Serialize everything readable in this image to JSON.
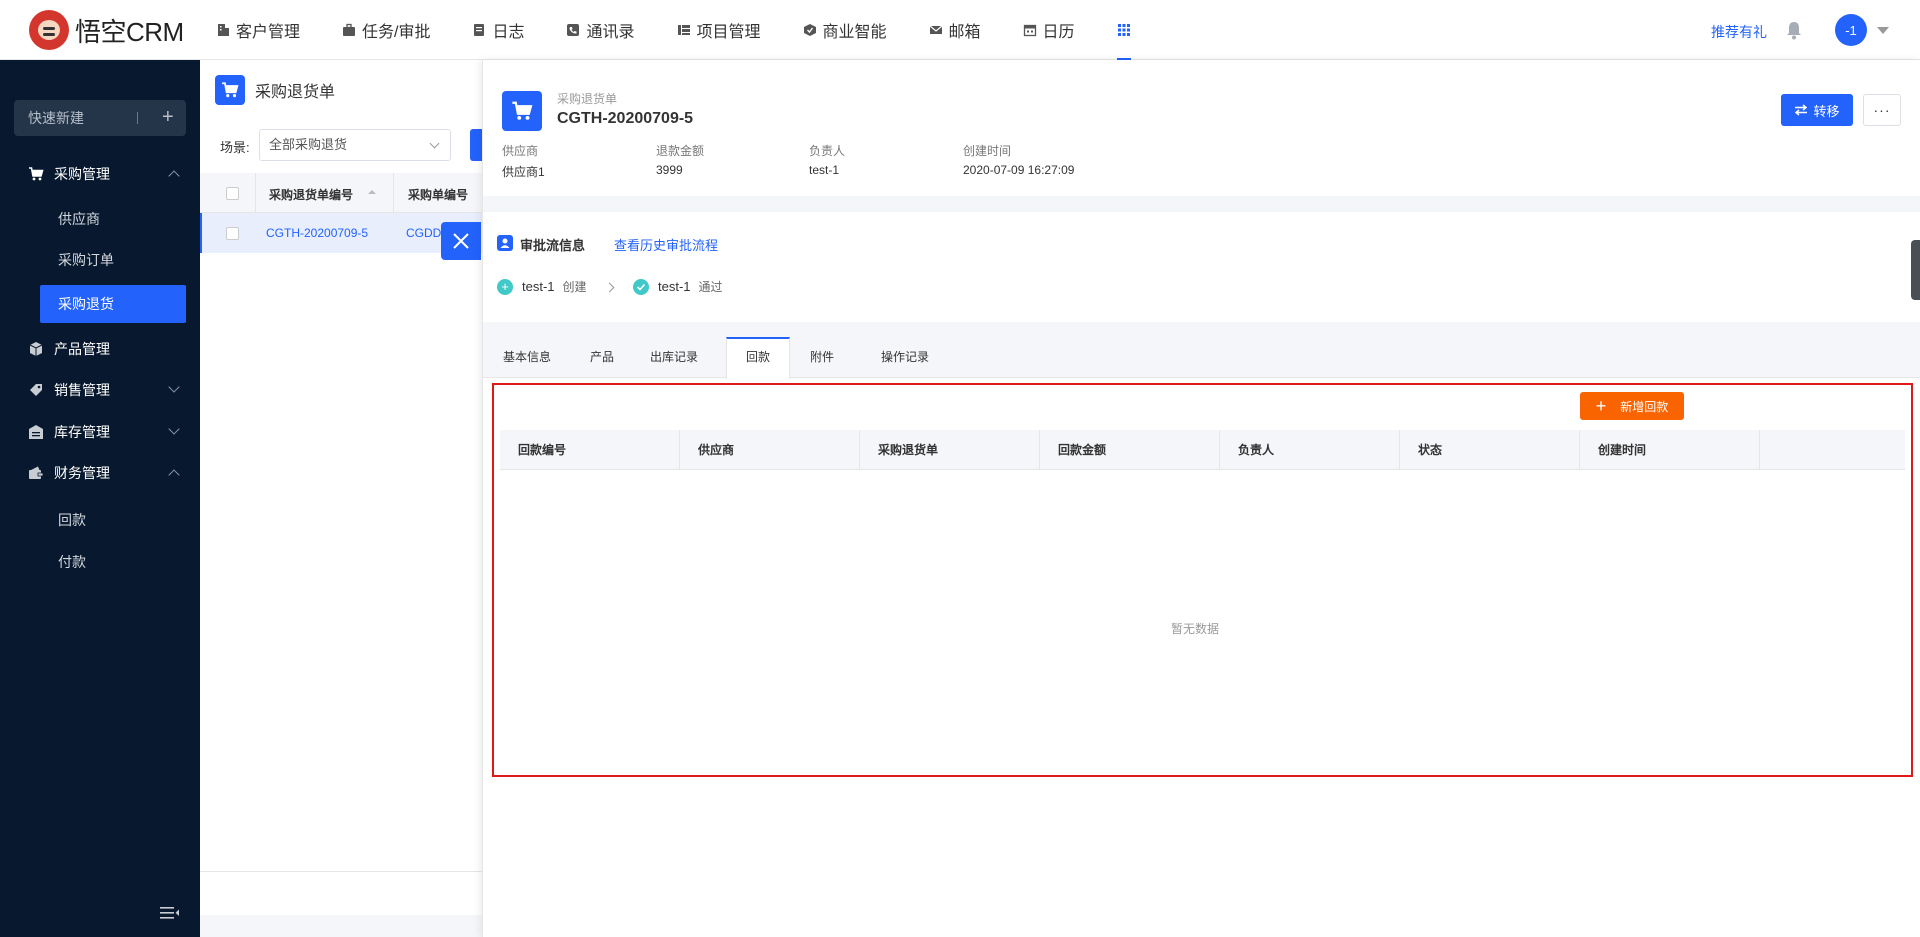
{
  "app": {
    "logo_text": "悟空CRM",
    "nav": [
      {
        "label": "客户管理",
        "icon": "building-icon"
      },
      {
        "label": "任务/审批",
        "icon": "briefcase-icon"
      },
      {
        "label": "日志",
        "icon": "log-icon"
      },
      {
        "label": "通讯录",
        "icon": "phone-icon"
      },
      {
        "label": "项目管理",
        "icon": "project-icon"
      },
      {
        "label": "商业智能",
        "icon": "bi-icon"
      },
      {
        "label": "邮箱",
        "icon": "mail-icon"
      },
      {
        "label": "日历",
        "icon": "calendar-icon"
      }
    ],
    "recommend": "推荐有礼",
    "avatar": "-1"
  },
  "sidebar": {
    "quick_new": "快速新建",
    "groups": [
      {
        "label": "采购管理",
        "icon": "cart-icon",
        "expanded": true,
        "items": [
          "供应商",
          "采购订单",
          "采购退货"
        ],
        "active_item": "采购退货"
      },
      {
        "label": "产品管理",
        "icon": "box-icon"
      },
      {
        "label": "销售管理",
        "icon": "tag-icon",
        "expanded": false
      },
      {
        "label": "库存管理",
        "icon": "warehouse-icon",
        "expanded": false
      },
      {
        "label": "财务管理",
        "icon": "wallet-icon",
        "expanded": true,
        "items": [
          "回款",
          "付款"
        ]
      }
    ]
  },
  "list": {
    "title": "采购退货单",
    "scene_label": "场景:",
    "scene_value": "全部采购退货",
    "columns": [
      "采购退货单编号",
      "采购单编号"
    ],
    "rows": [
      {
        "code": "CGTH-20200709-5",
        "order_code": "CGDD"
      }
    ]
  },
  "detail": {
    "type_label": "采购退货单",
    "code": "CGTH-20200709-5",
    "transfer_label": "转移",
    "more_label": "···",
    "fields": [
      {
        "label": "供应商",
        "value": "供应商1"
      },
      {
        "label": "退款金额",
        "value": "3999"
      },
      {
        "label": "负责人",
        "value": "test-1"
      },
      {
        "label": "创建时间",
        "value": "2020-07-09 16:27:09"
      }
    ],
    "approval": {
      "title": "审批流信息",
      "history_link": "查看历史审批流程",
      "steps": [
        {
          "user": "test-1",
          "action": "创建",
          "icon": "plus-circle-icon"
        },
        {
          "user": "test-1",
          "action": "通过",
          "icon": "check-circle-icon"
        }
      ]
    },
    "tabs": [
      "基本信息",
      "产品",
      "出库记录",
      "回款",
      "附件",
      "操作记录"
    ],
    "active_tab": "回款",
    "payment": {
      "add_label": "新增回款",
      "columns": [
        "回款编号",
        "供应商",
        "采购退货单",
        "回款金额",
        "负责人",
        "状态",
        "创建时间"
      ],
      "empty_text": "暂无数据"
    }
  },
  "colors": {
    "primary": "#2362fb",
    "sidebar_bg": "#08182e",
    "add_button": "#fa6400",
    "highlight_box": "#e21818"
  }
}
